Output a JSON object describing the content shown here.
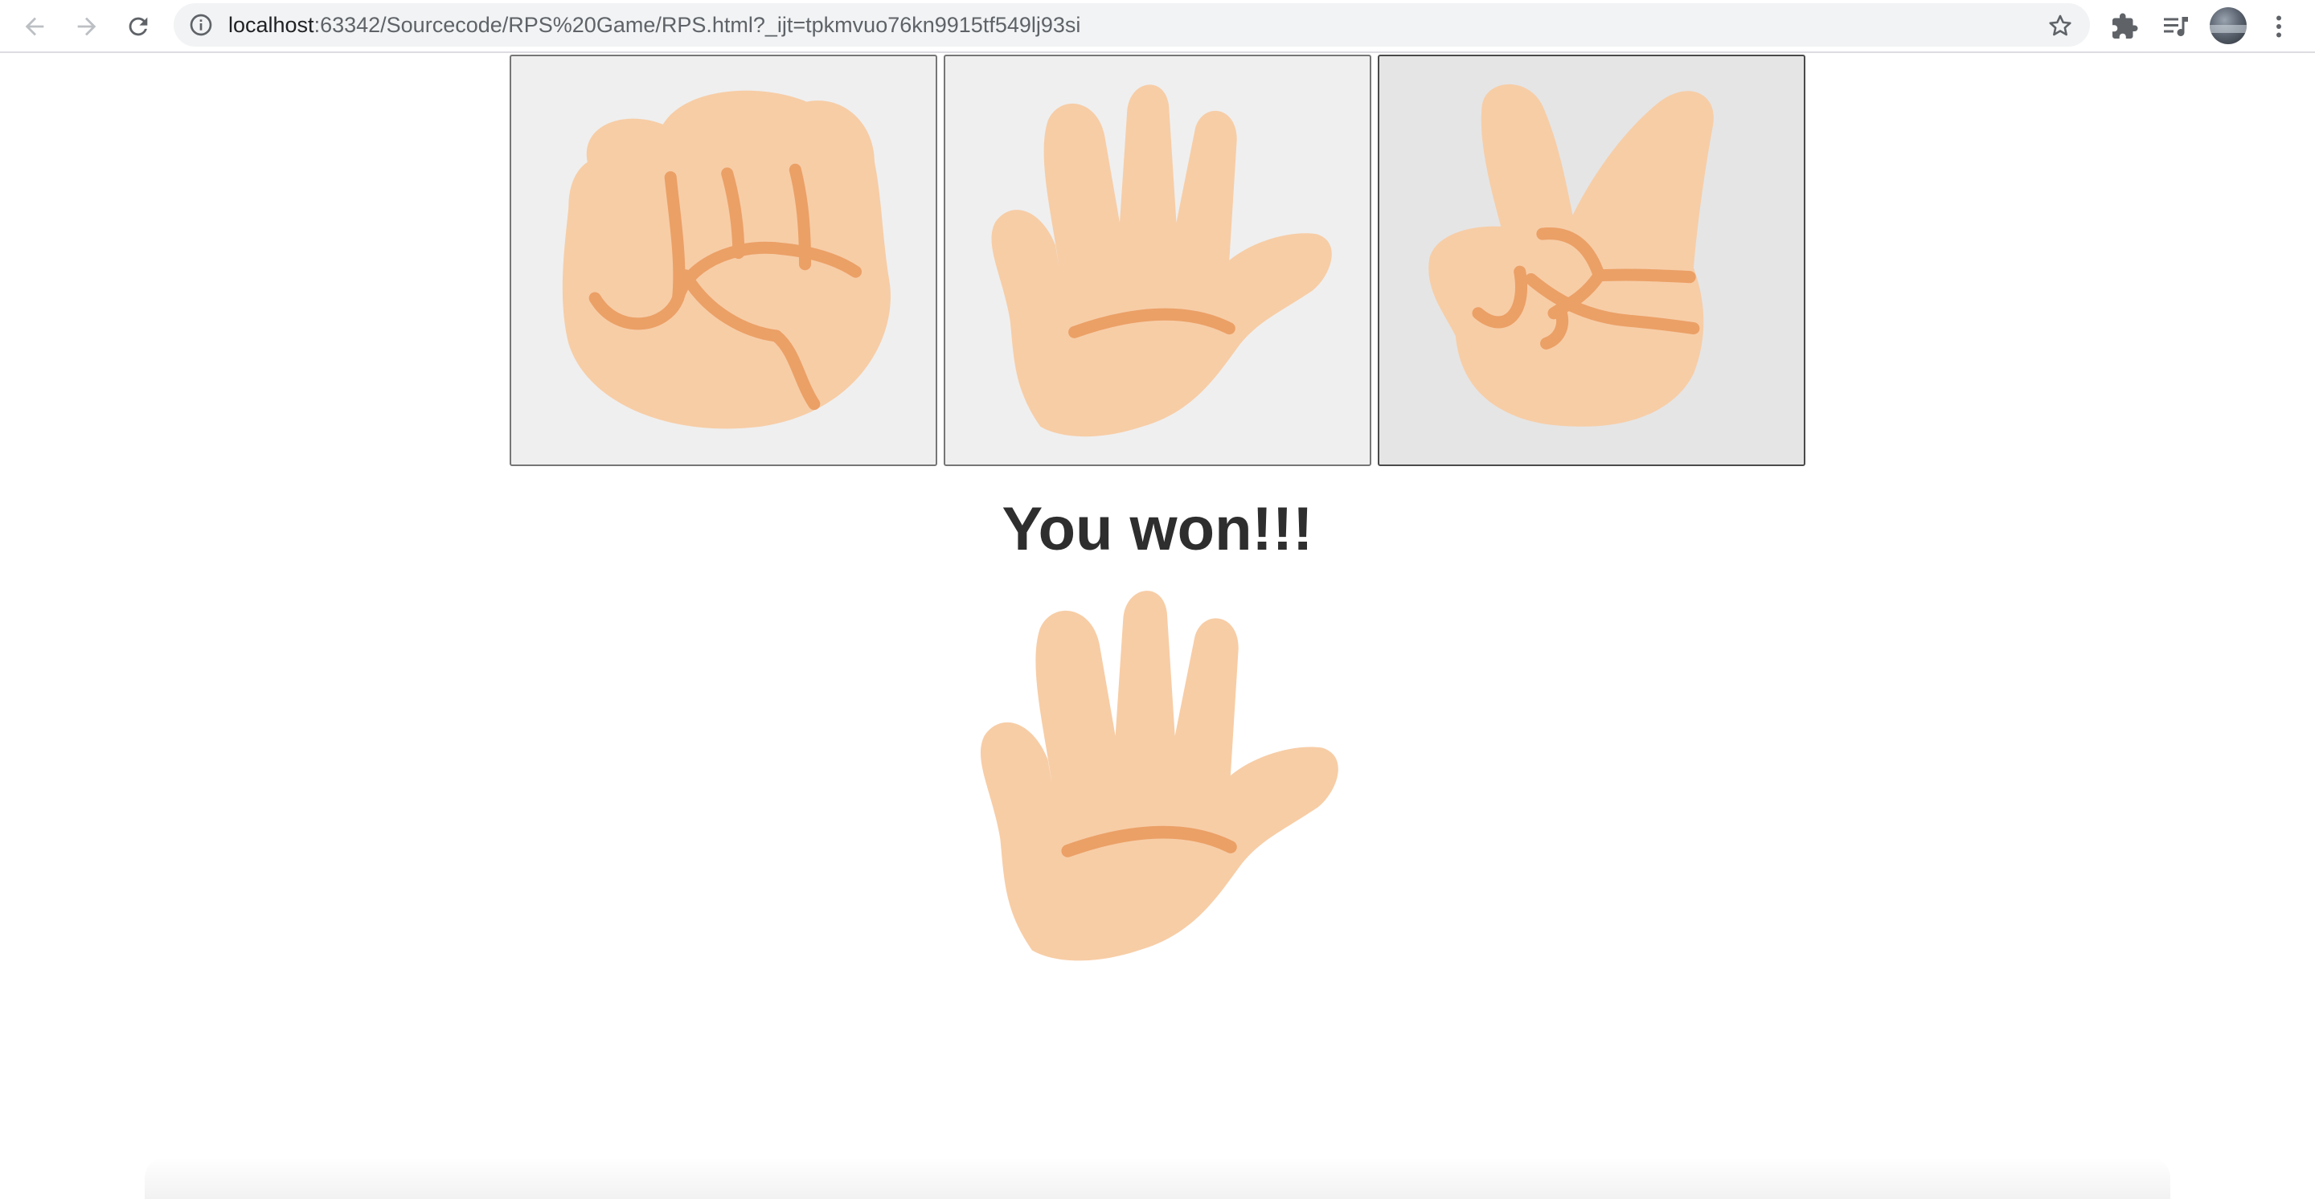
{
  "browser": {
    "url_host": "localhost",
    "url_rest": ":63342/Sourcecode/RPS%20Game/RPS.html?_ijt=tpkmvuo76kn9915tf549lj93si"
  },
  "icons": {
    "back": "arrow-left-icon",
    "forward": "arrow-right-icon",
    "reload": "reload-icon",
    "site_info": "info-icon",
    "bookmark": "star-icon",
    "extensions": "puzzle-icon",
    "media": "playlist-icon",
    "profile": "avatar",
    "menu": "kebab-menu-icon"
  },
  "choices": [
    {
      "id": "rock",
      "image": "fist-hand-icon"
    },
    {
      "id": "paper",
      "image": "open-hand-icon"
    },
    {
      "id": "scissors",
      "image": "peace-hand-icon",
      "state": "hovered"
    }
  ],
  "result": {
    "message": "You won!!!",
    "computer_choice": "paper",
    "image": "open-hand-icon"
  },
  "colors": {
    "skin": "#f7cda6",
    "crease": "#eba066",
    "button_bg": "#efefef",
    "button_hover_bg": "#e5e5e5",
    "text": "#2e2e2e"
  }
}
